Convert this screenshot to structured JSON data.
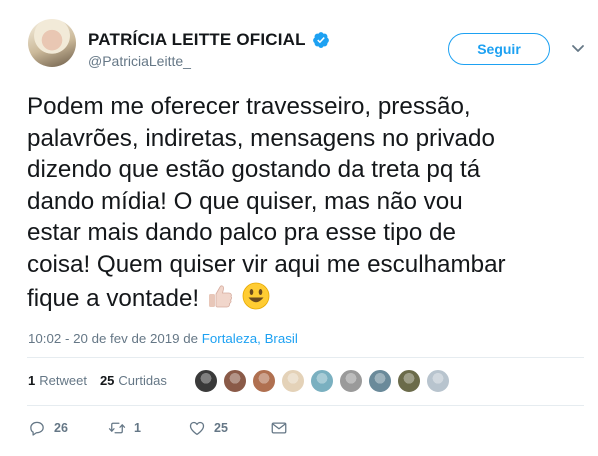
{
  "author": {
    "display_name": "PATRÍCIA LEITTE OFICIAL",
    "handle": "@PatriciaLeitte_",
    "verified_icon": "verified-badge-icon"
  },
  "follow_button": {
    "label": "Seguir"
  },
  "tweet": {
    "text": "Podem me oferecer travesseiro, pressão,\npalavrões, indiretas, mensagens no privado\ndizendo que estão gostando da treta pq tá\ndando mídia! O que quiser, mas não vou\nestar mais dando palco pra esse tipo de\ncoisa! Quem quiser vir aqui me esculhambar\nfique a vontade!",
    "emojis": [
      "thumbs-up-icon",
      "smiley-icon"
    ]
  },
  "timestamp": {
    "time_date": "10:02 - 20 de fev de 2019 de ",
    "location": "Fortaleza, Brasil"
  },
  "stats": {
    "retweets_count": "1",
    "retweets_label": "Retweet",
    "likes_count": "25",
    "likes_label": "Curtidas"
  },
  "likers": [
    {
      "name": "liker-avatar",
      "color": "#3a3a3a"
    },
    {
      "name": "liker-avatar",
      "color": "#8a5a48"
    },
    {
      "name": "liker-avatar",
      "color": "#b07050"
    },
    {
      "name": "liker-avatar",
      "color": "#e4d2b8"
    },
    {
      "name": "liker-avatar",
      "color": "#7ab0c0"
    },
    {
      "name": "liker-avatar",
      "color": "#9a9a9a"
    },
    {
      "name": "liker-avatar",
      "color": "#6a8a9a"
    },
    {
      "name": "liker-avatar",
      "color": "#6b6b4a"
    },
    {
      "name": "liker-avatar",
      "color": "#b8c4ce"
    }
  ],
  "actions": {
    "reply_count": "26",
    "retweet_count": "1",
    "like_count": "25"
  },
  "colors": {
    "accent": "#1da1f2",
    "secondary_text": "#657786",
    "primary_text": "#14171a"
  }
}
